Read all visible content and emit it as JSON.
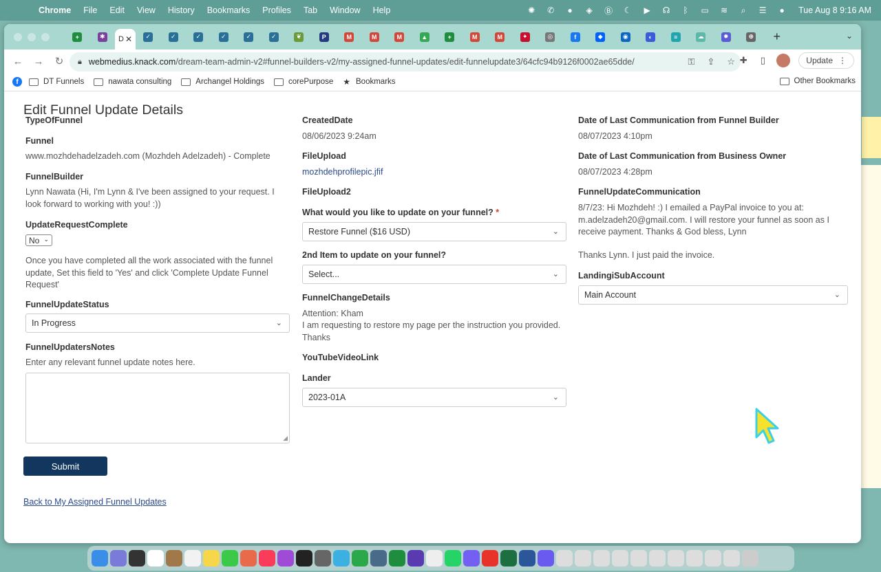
{
  "menubar": {
    "app": "Chrome",
    "items": [
      "File",
      "Edit",
      "View",
      "History",
      "Bookmarks",
      "Profiles",
      "Tab",
      "Window",
      "Help"
    ],
    "clock": "Tue Aug 8  9:16 AM"
  },
  "browser": {
    "url_domain": "webmedius.knack.com",
    "url_path": "/dream-team-admin-v2#funnel-builders-v2/my-assigned-funnel-updates/edit-funnelupdate3/64cfc94b9126f0002ae65dde/",
    "update_label": "Update",
    "active_tab_letter": "D",
    "bookmarks": [
      "DT Funnels",
      "nawata consulting",
      "Archangel Holdings",
      "corePurpose",
      "Bookmarks"
    ],
    "other_bookmarks": "Other Bookmarks"
  },
  "page": {
    "title": "Edit Funnel Update Details",
    "col1": {
      "type_of_funnel_label": "TypeOfFunnel",
      "funnel_label": "Funnel",
      "funnel_value": "www.mozhdehadelzadeh.com (Mozhdeh Adelzadeh) - Complete",
      "funnel_builder_label": "FunnelBuilder",
      "funnel_builder_value": "Lynn Nawata (Hi, I'm Lynn & I've been assigned to your request. I look forward to working with you! :))",
      "update_complete_label": "UpdateRequestComplete",
      "update_complete_value": "No",
      "update_complete_help": "Once you have completed all the work associated with the funnel update, Set this field to 'Yes' and click 'Complete Update Funnel Request'",
      "status_label": "FunnelUpdateStatus",
      "status_value": "In Progress",
      "notes_label": "FunnelUpdatersNotes",
      "notes_help": "Enter any relevant funnel update notes here.",
      "submit_label": "Submit",
      "back_link": "Back to My Assigned Funnel Updates"
    },
    "col2": {
      "created_label": "CreatedDate",
      "created_value": "08/06/2023 9:24am",
      "fileupload_label": "FileUpload",
      "fileupload_value": "mozhdehprofilepic.jfif",
      "fileupload2_label": "FileUpload2",
      "update_q_label": "What would you like to update on your funnel?",
      "required_mark": "*",
      "update_q_value": "Restore Funnel ($16 USD)",
      "second_item_label": "2nd Item to update on your funnel?",
      "second_item_value": "Select...",
      "change_details_label": "FunnelChangeDetails",
      "change_details_line1": "Attention: Kham",
      "change_details_line2": "I am requesting to restore my page per the instruction you provided. Thanks",
      "youtube_label": "YouTubeVideoLink",
      "lander_label": "Lander",
      "lander_value": "2023-01A"
    },
    "col3": {
      "last_comm_builder_label": "Date of Last Communication from Funnel Builder",
      "last_comm_builder_value": "08/07/2023 4:10pm",
      "last_comm_owner_label": "Date of Last Communication from Business Owner",
      "last_comm_owner_value": "08/07/2023 4:28pm",
      "communication_label": "FunnelUpdateCommunication",
      "communication_msg1": "8/7/23: Hi Mozhdeh! :) I emailed a PayPal invoice to you at: m.adelzadeh20@gmail.com. I will restore your funnel as soon as I receive payment. Thanks & God bless, Lynn",
      "communication_msg2": "Thanks Lynn. I just paid the invoice.",
      "subaccount_label": "LandingiSubAccount",
      "subaccount_value": "Main Account"
    }
  },
  "colors": {
    "menubar": "#5f9e96",
    "tabstrip": "#a9d8d0",
    "submit": "#13365f",
    "link": "#2b4a8c"
  }
}
